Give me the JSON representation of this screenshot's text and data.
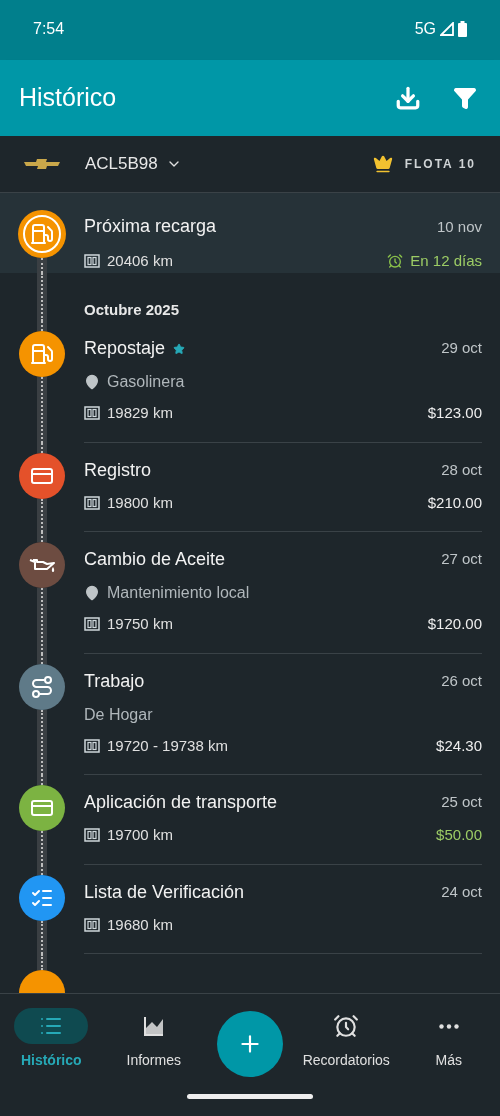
{
  "status_bar": {
    "time": "7:54",
    "network": "5G"
  },
  "app_bar": {
    "title": "Histórico"
  },
  "vehicle": {
    "plate": "ACL5B98",
    "plan": "FLOTA 10"
  },
  "upcoming": {
    "kind": "fuel",
    "title": "Próxima recarga",
    "date": "10 nov",
    "odometer": "20406 km",
    "reminder": "En 12 días",
    "color": "#f59300"
  },
  "month": "Octubre 2025",
  "entries": [
    {
      "kind": "fuel",
      "title": "Repostaje",
      "starred": true,
      "date": "29 oct",
      "place": "Gasolinera",
      "odometer": "19829 km",
      "amount": "$123.00",
      "income": false,
      "color": "#f59300"
    },
    {
      "kind": "expense",
      "title": "Registro",
      "starred": false,
      "date": "28 oct",
      "odometer": "19800 km",
      "amount": "$210.00",
      "income": false,
      "color": "#e4512a"
    },
    {
      "kind": "oil",
      "title": "Cambio de Aceite",
      "starred": false,
      "date": "27 oct",
      "place": "Mantenimiento local",
      "odometer": "19750 km",
      "amount": "$120.00",
      "income": false,
      "color": "#6d4c41"
    },
    {
      "kind": "route",
      "title": "Trabajo",
      "starred": false,
      "date": "26 oct",
      "note": "De Hogar",
      "odometer": "19720 - 19738 km",
      "amount": "$24.30",
      "income": false,
      "color": "#5f7a88"
    },
    {
      "kind": "income",
      "title": "Aplicación de transporte",
      "starred": false,
      "date": "25 oct",
      "odometer": "19700 km",
      "amount": "$50.00",
      "income": true,
      "color": "#7cb342"
    },
    {
      "kind": "checklist",
      "title": "Lista de Verificación",
      "starred": false,
      "date": "24 oct",
      "odometer": "19680 km",
      "color": "#2196f3"
    }
  ],
  "peek": {
    "color": "#f59300"
  },
  "nav": [
    {
      "kind": "history",
      "label": "Histórico",
      "selected": true
    },
    {
      "kind": "reports",
      "label": "Informes",
      "selected": false
    },
    {
      "kind": "reminders",
      "label": "Recordatorios",
      "selected": false
    },
    {
      "kind": "more",
      "label": "Más",
      "selected": false
    }
  ]
}
